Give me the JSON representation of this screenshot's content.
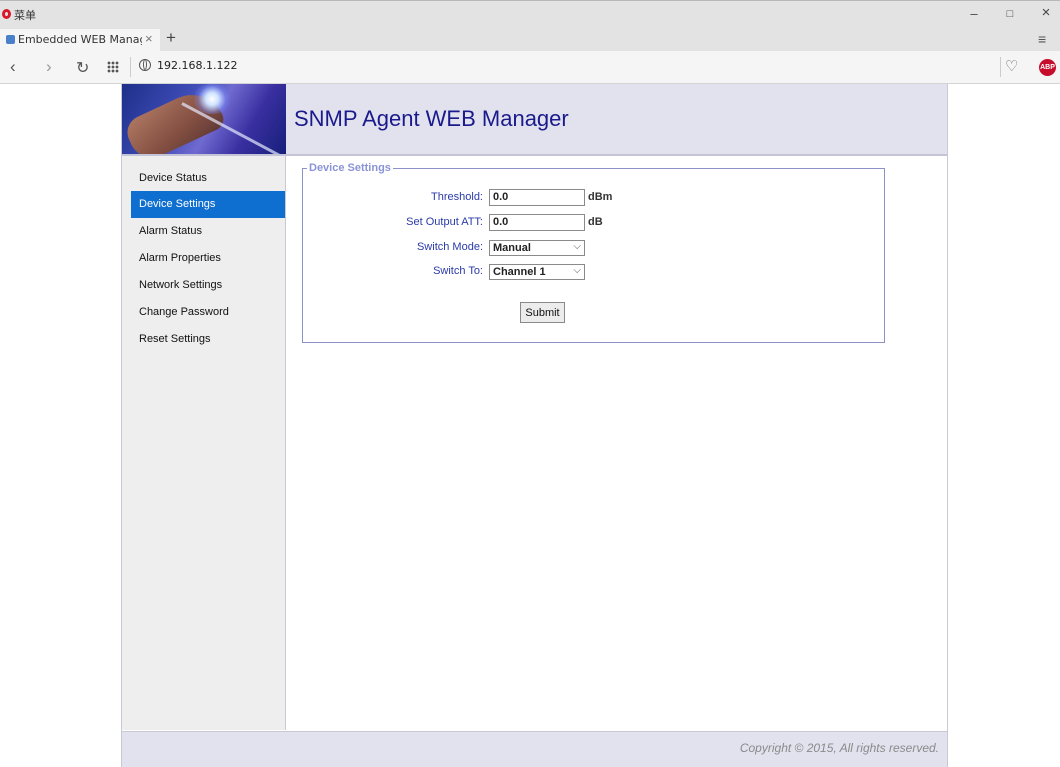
{
  "browser": {
    "menu_label": "菜单",
    "tab_title": "Embedded WEB Manage",
    "url": "192.168.1.122",
    "window_controls": {
      "minimize": "–",
      "maximize": "□",
      "close": "×"
    },
    "icons": [
      "opera-logo-icon",
      "back-icon",
      "forward-icon",
      "reload-icon",
      "speed-dial-icon",
      "globe-icon",
      "heart-icon",
      "adblock-icon"
    ],
    "abp_label": "ABP"
  },
  "header": {
    "title": "SNMP Agent WEB Manager"
  },
  "sidebar": {
    "items": [
      {
        "label": "Device Status"
      },
      {
        "label": "Device Settings",
        "active": true
      },
      {
        "label": "Alarm Status"
      },
      {
        "label": "Alarm Properties"
      },
      {
        "label": "Network Settings"
      },
      {
        "label": "Change Password"
      },
      {
        "label": "Reset Settings"
      }
    ],
    "active_color": "#0f6fd0"
  },
  "device_settings": {
    "legend": "Device Settings",
    "threshold": {
      "label": "Threshold:",
      "value": "0.0",
      "unit": "dBm"
    },
    "output_att": {
      "label": "Set Output ATT:",
      "value": "0.0",
      "unit": "dB"
    },
    "switch_mode": {
      "label": "Switch Mode:",
      "value": "Manual"
    },
    "switch_to": {
      "label": "Switch To:",
      "value": "Channel 1"
    },
    "submit_label": "Submit"
  },
  "footer": {
    "copyright": "Copyright © 2015, All rights reserved."
  }
}
